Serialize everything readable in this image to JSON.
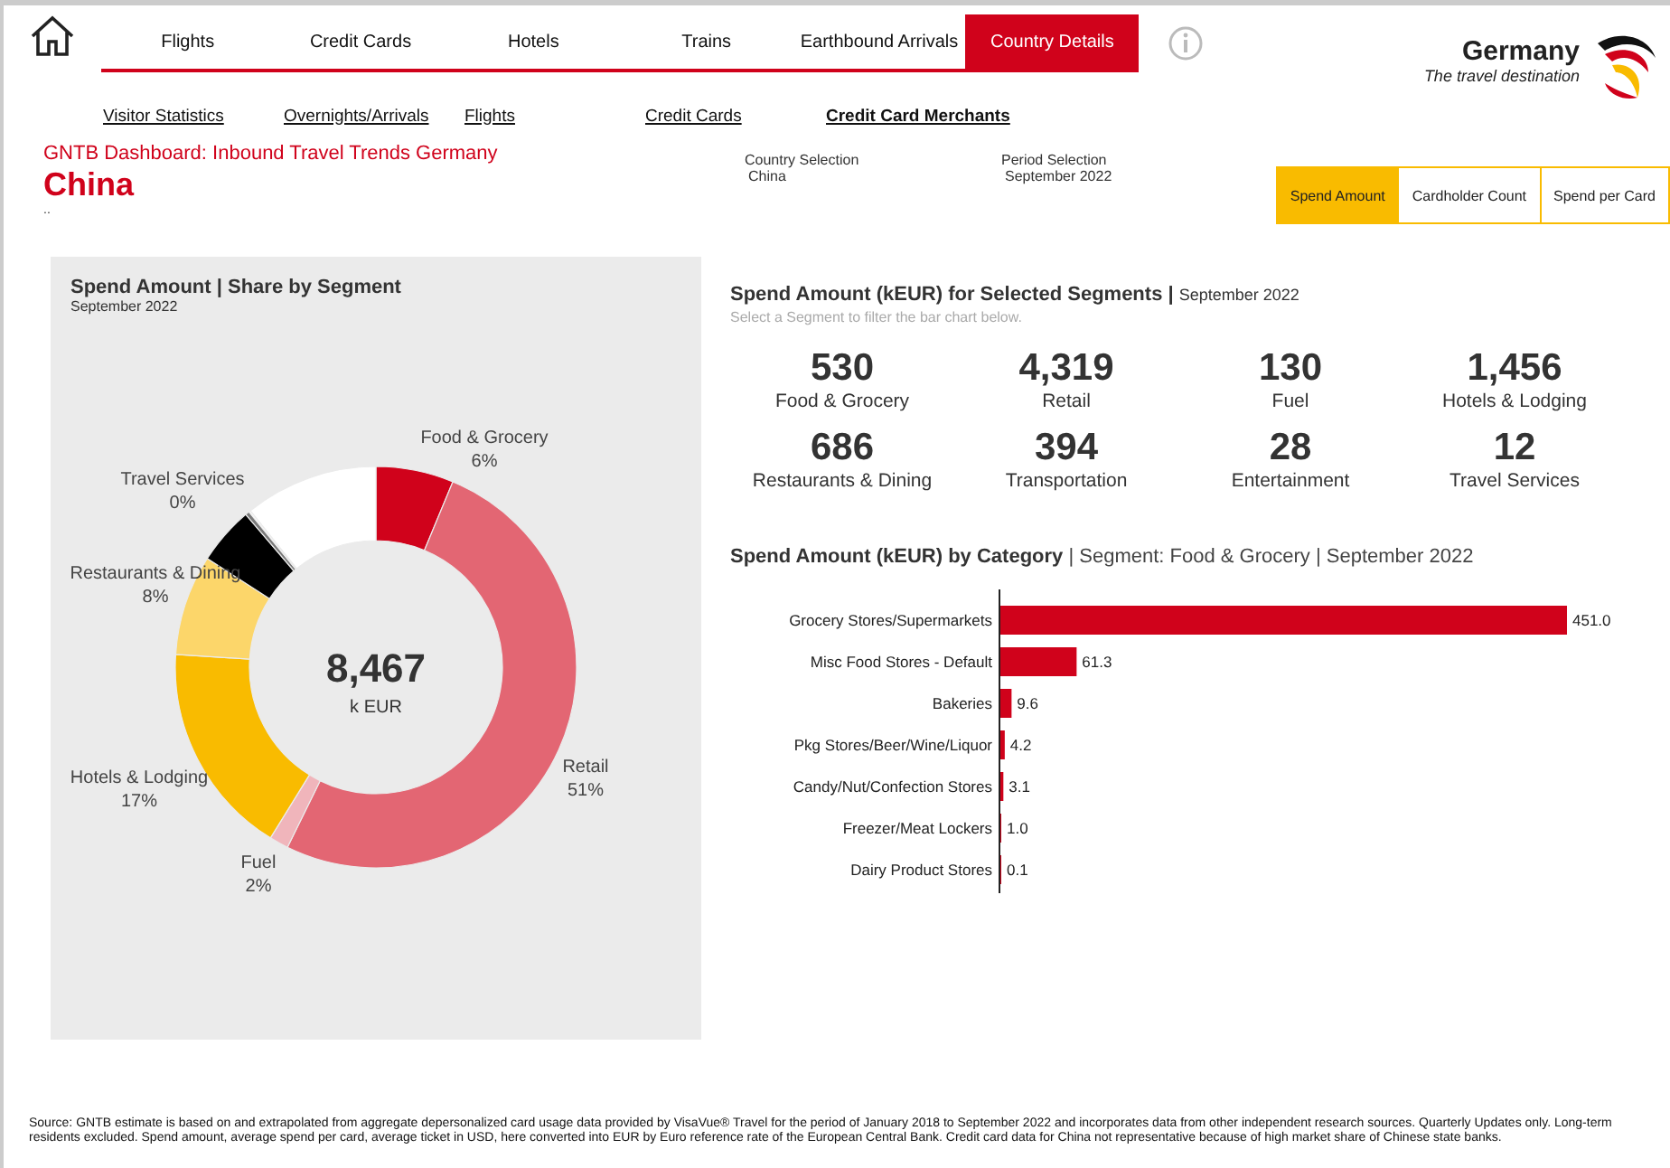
{
  "nav": {
    "tabs": [
      {
        "label": "Flights",
        "selected": false
      },
      {
        "label": "Credit Cards",
        "selected": false
      },
      {
        "label": "Hotels",
        "selected": false
      },
      {
        "label": "Trains",
        "selected": false
      },
      {
        "label": "Earthbound Arrivals",
        "selected": false
      },
      {
        "label": "Country Details",
        "selected": true
      }
    ],
    "subtabs": [
      {
        "label": "Visitor Statistics",
        "selected": false
      },
      {
        "label": "Overnights/Arrivals",
        "selected": false
      },
      {
        "label": "Flights",
        "selected": false
      },
      {
        "label": "Credit Cards",
        "selected": false
      },
      {
        "label": "Credit Card Merchants",
        "selected": true
      }
    ]
  },
  "logo": {
    "title": "Germany",
    "tagline": "The travel destination"
  },
  "header": {
    "dashboard": "GNTB Dashboard: Inbound Travel Trends Germany",
    "country": "China",
    "note": "..",
    "filters": [
      {
        "label": "Country Selection",
        "value": "China"
      },
      {
        "label": "Period Selection",
        "value": "September 2022"
      }
    ],
    "measures": [
      {
        "label": "Spend Amount",
        "selected": true
      },
      {
        "label": "Cardholder Count",
        "selected": false
      },
      {
        "label": "Spend per Card",
        "selected": false
      }
    ]
  },
  "share_panel": {
    "title": "Spend Amount | Share by Segment",
    "subtitle": "September 2022",
    "total": "8,467",
    "unit": "k EUR",
    "chart_data": {
      "type": "donut",
      "categories": [
        "Food & Grocery",
        "Retail",
        "Fuel",
        "Hotels & Lodging",
        "Restaurants & Dining",
        null,
        null,
        "Travel Services",
        null
      ],
      "values": [
        6.26,
        51.01,
        1.54,
        17.2,
        8.1,
        4.65,
        0.33,
        0.14,
        10.77
      ],
      "colors": [
        "#d0021b",
        "#e36673",
        "#f0b5bb",
        "#f9bb00",
        "#fcd66a",
        "#000000",
        "#7a7a7a",
        "#ffffff",
        "#ffffff"
      ],
      "value_labels": [
        "6%",
        "51%",
        "2%",
        "17%",
        "8%",
        null,
        null,
        "0%",
        null
      ]
    }
  },
  "segments_panel": {
    "title": "Spend Amount (kEUR) for Selected Segments",
    "separator": "|",
    "period": "September 2022",
    "hint": "Select a Segment to filter the bar chart below.",
    "kpis": [
      {
        "value": "530",
        "name": "Food & Grocery"
      },
      {
        "value": "4,319",
        "name": "Retail"
      },
      {
        "value": "130",
        "name": "Fuel"
      },
      {
        "value": "1,456",
        "name": "Hotels & Lodging"
      },
      {
        "value": "686",
        "name": "Restaurants & Dining"
      },
      {
        "value": "394",
        "name": "Transportation"
      },
      {
        "value": "28",
        "name": "Entertainment"
      },
      {
        "value": "12",
        "name": "Travel Services"
      }
    ]
  },
  "category_panel": {
    "title": "Spend Amount (kEUR) by Category",
    "context": "| Segment: Food & Grocery | September 2022",
    "chart_data": {
      "type": "bar",
      "orientation": "horizontal",
      "categories": [
        "Grocery Stores/Supermarkets",
        "Misc Food Stores - Default",
        "Bakeries",
        "Pkg Stores/Beer/Wine/Liquor",
        "Candy/Nut/Confection Stores",
        "Freezer/Meat Lockers",
        "Dairy Product Stores"
      ],
      "values": [
        451.0,
        61.3,
        9.6,
        4.2,
        3.1,
        1.0,
        0.1
      ],
      "value_labels": [
        "451.0",
        "61.3",
        "9.6",
        "4.2",
        "3.1",
        "1.0",
        "0.1"
      ]
    }
  },
  "footer": "Source: GNTB estimate is based on and extrapolated from aggregate depersonalized card usage data provided by VisaVue® Travel for the period of January 2018 to September 2022 and incorporates data from other independent research sources. Quarterly Updates only. Long-term residents excluded. Spend amount, average spend per card, average ticket in USD, here converted into EUR by Euro reference rate of the European Central Bank. Credit card data for China not representative because of high market share of Chinese state banks."
}
